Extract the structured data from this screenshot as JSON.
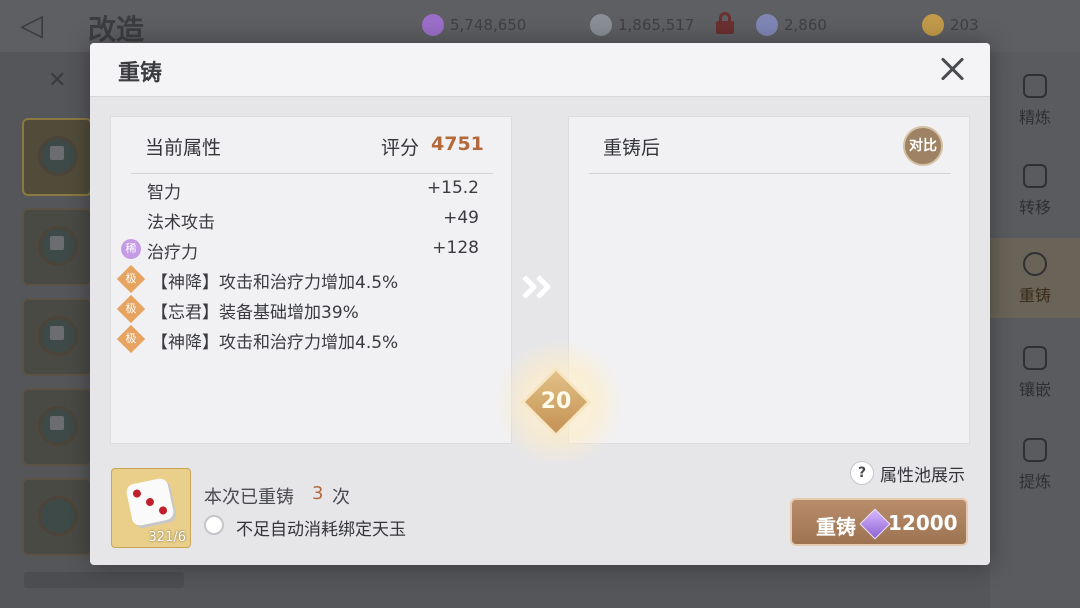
{
  "background": {
    "title": "改造",
    "resources": [
      {
        "value": "5,748,650",
        "color": "#9a6fc9"
      },
      {
        "value": "1,865,517",
        "color": "#8a8e96"
      },
      {
        "value": "2,860",
        "color": "#7f86b5"
      },
      {
        "value": "203",
        "color": "#c29a4a"
      }
    ],
    "tabs": [
      "精炼",
      "转移",
      "重铸",
      "镶嵌",
      "提炼"
    ],
    "active_tab": "重铸"
  },
  "dialog": {
    "title": "重铸",
    "current": {
      "title": "当前属性",
      "score_label": "评分",
      "score": "4751",
      "attributes": [
        {
          "name": "智力",
          "value": "+15.2"
        },
        {
          "name": "法术攻击",
          "value": "+49"
        },
        {
          "name": "治疗力",
          "value": "+128",
          "badge": "稀"
        }
      ],
      "special": [
        {
          "badge": "极",
          "text": "【神降】攻击和治疗力增加4.5%"
        },
        {
          "badge": "极",
          "text": "【忘君】装备基础增加39%"
        },
        {
          "badge": "极",
          "text": "【神降】攻击和治疗力增加4.5%"
        }
      ]
    },
    "after": {
      "title": "重铸后",
      "compare_label": "对比"
    },
    "level": "20",
    "dice_count": "321/6",
    "reforge_count_label": "本次已重铸",
    "reforge_count": "3",
    "reforge_count_unit": "次",
    "auto_consume_label": "不足自动消耗绑定天玉",
    "pool_label": "属性池展示",
    "reforge_button_label": "重铸",
    "reforge_cost": "12000"
  }
}
